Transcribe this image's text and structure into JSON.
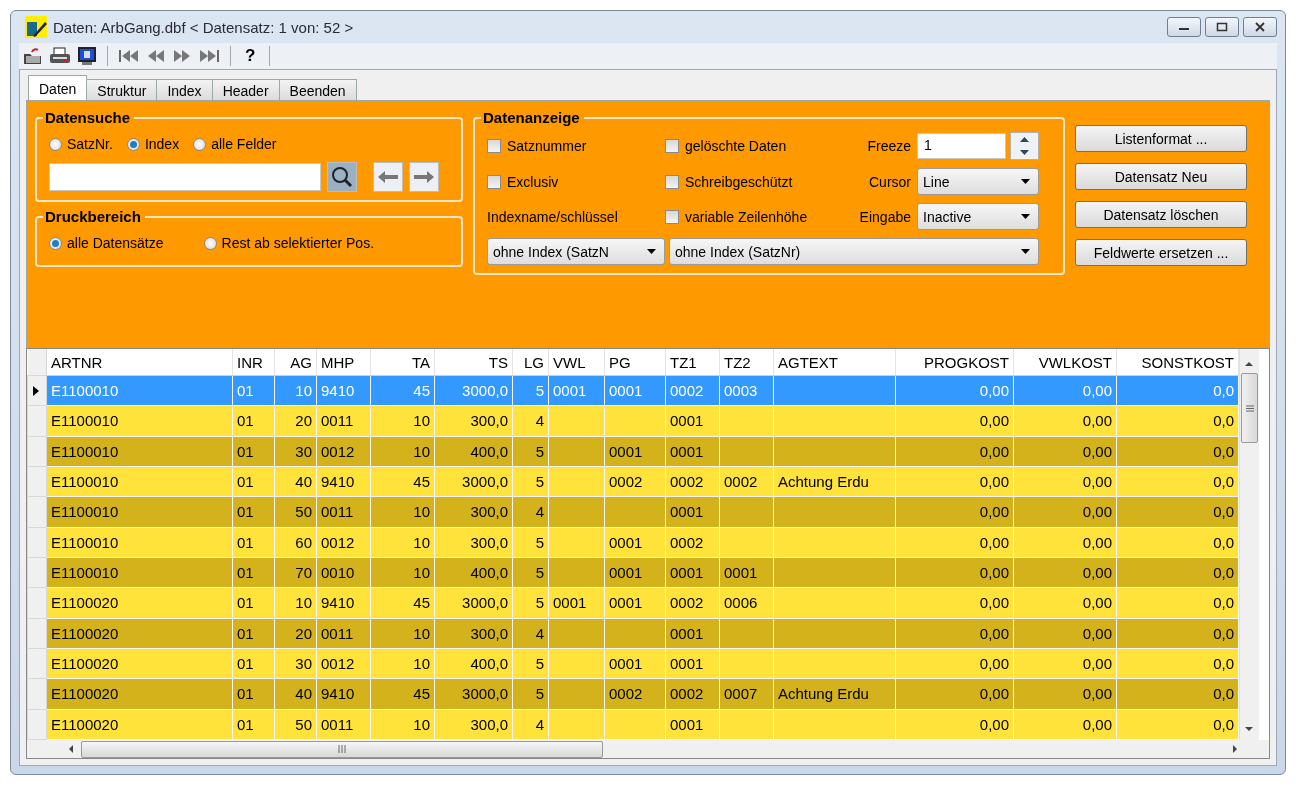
{
  "window": {
    "title": "Daten: ArbGang.dbf < Datensatz: 1 von: 52 >"
  },
  "toolbar": {
    "help_label": "?"
  },
  "tabs": [
    {
      "label": "Daten",
      "selected": true
    },
    {
      "label": "Struktur",
      "selected": false
    },
    {
      "label": "Index",
      "selected": false
    },
    {
      "label": "Header",
      "selected": false
    },
    {
      "label": "Beenden",
      "selected": false
    }
  ],
  "datensuche": {
    "title": "Datensuche",
    "radios": [
      {
        "label": "SatzNr.",
        "selected": false
      },
      {
        "label": "Index",
        "selected": true
      },
      {
        "label": "alle Felder",
        "selected": false
      }
    ]
  },
  "druckbereich": {
    "title": "Druckbereich",
    "radios": [
      {
        "label": "alle Datensätze",
        "selected": true
      },
      {
        "label": "Rest ab selektierter Pos.",
        "selected": false
      }
    ]
  },
  "datenanzeige": {
    "title": "Datenanzeige",
    "checkboxes": [
      {
        "label": "Satznummer",
        "checked": false
      },
      {
        "label": "gelöschte Daten",
        "checked": false
      },
      {
        "label": "Exclusiv",
        "checked": false
      },
      {
        "label": "Schreibgeschützt",
        "checked": false
      },
      {
        "label": "variable Zeilenhöhe",
        "checked": false
      }
    ],
    "index_label": "Indexname/schlüssel",
    "freeze": {
      "label": "Freeze",
      "value": "1"
    },
    "cursor": {
      "label": "Cursor",
      "value": "Line"
    },
    "eingabe": {
      "label": "Eingabe",
      "value": "Inactive"
    },
    "index_name": "ohne Index (SatzN",
    "index_key": "ohne Index (SatzNr)"
  },
  "buttons": [
    "Listenformat ...",
    "Datensatz Neu",
    "Datensatz löschen",
    "Feldwerte ersetzen ..."
  ],
  "table": {
    "columns": [
      "ARTNR",
      "INR",
      "AG",
      "MHP",
      "TA",
      "TS",
      "LG",
      "VWL",
      "PG",
      "TZ1",
      "TZ2",
      "AGTEXT",
      "PROGKOST",
      "VWLKOST",
      "SONSTKOST"
    ],
    "rows": [
      {
        "selected": true,
        "cells": [
          "E1100010",
          "01",
          "10",
          "9410",
          "45",
          "3000,0",
          "5",
          "0001",
          "0001",
          "0002",
          "0003",
          "",
          "0,00",
          "0,00",
          "0,0"
        ]
      },
      {
        "selected": false,
        "cells": [
          "E1100010",
          "01",
          "20",
          "0011",
          "10",
          "300,0",
          "4",
          "",
          "",
          "0001",
          "",
          "",
          "0,00",
          "0,00",
          "0,0"
        ]
      },
      {
        "selected": false,
        "cells": [
          "E1100010",
          "01",
          "30",
          "0012",
          "10",
          "400,0",
          "5",
          "",
          "0001",
          "0001",
          "",
          "",
          "0,00",
          "0,00",
          "0,0"
        ]
      },
      {
        "selected": false,
        "cells": [
          "E1100010",
          "01",
          "40",
          "9410",
          "45",
          "3000,0",
          "5",
          "",
          "0002",
          "0002",
          "0002",
          "Achtung Erdu",
          "0,00",
          "0,00",
          "0,0"
        ]
      },
      {
        "selected": false,
        "cells": [
          "E1100010",
          "01",
          "50",
          "0011",
          "10",
          "300,0",
          "4",
          "",
          "",
          "0001",
          "",
          "",
          "0,00",
          "0,00",
          "0,0"
        ]
      },
      {
        "selected": false,
        "cells": [
          "E1100010",
          "01",
          "60",
          "0012",
          "10",
          "300,0",
          "5",
          "",
          "0001",
          "0002",
          "",
          "",
          "0,00",
          "0,00",
          "0,0"
        ]
      },
      {
        "selected": false,
        "cells": [
          "E1100010",
          "01",
          "70",
          "0010",
          "10",
          "400,0",
          "5",
          "",
          "0001",
          "0001",
          "0001",
          "",
          "0,00",
          "0,00",
          "0,0"
        ]
      },
      {
        "selected": false,
        "cells": [
          "E1100020",
          "01",
          "10",
          "9410",
          "45",
          "3000,0",
          "5",
          "0001",
          "0001",
          "0002",
          "0006",
          "",
          "0,00",
          "0,00",
          "0,0"
        ]
      },
      {
        "selected": false,
        "cells": [
          "E1100020",
          "01",
          "20",
          "0011",
          "10",
          "300,0",
          "4",
          "",
          "",
          "0001",
          "",
          "",
          "0,00",
          "0,00",
          "0,0"
        ]
      },
      {
        "selected": false,
        "cells": [
          "E1100020",
          "01",
          "30",
          "0012",
          "10",
          "400,0",
          "5",
          "",
          "0001",
          "0001",
          "",
          "",
          "0,00",
          "0,00",
          "0,0"
        ]
      },
      {
        "selected": false,
        "cells": [
          "E1100020",
          "01",
          "40",
          "9410",
          "45",
          "3000,0",
          "5",
          "",
          "0002",
          "0002",
          "0007",
          "Achtung Erdu",
          "0,00",
          "0,00",
          "0,0"
        ]
      },
      {
        "selected": false,
        "cells": [
          "E1100020",
          "01",
          "50",
          "0011",
          "10",
          "300,0",
          "4",
          "",
          "",
          "0001",
          "",
          "",
          "0,00",
          "0,00",
          "0,0"
        ]
      }
    ]
  }
}
